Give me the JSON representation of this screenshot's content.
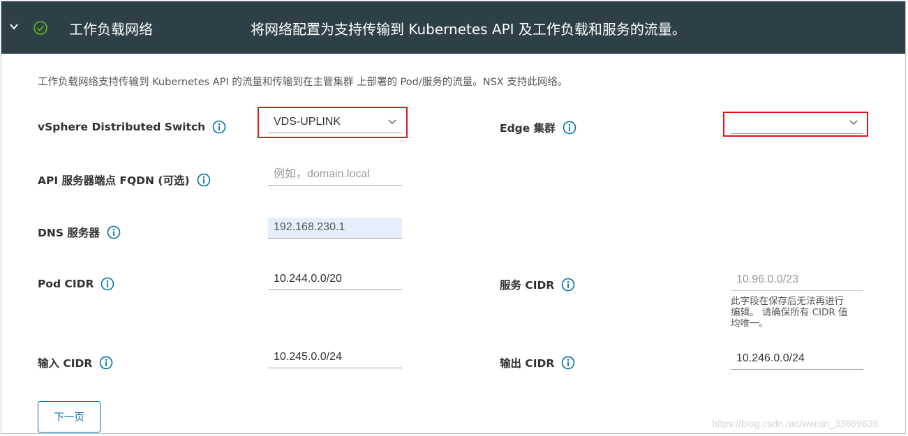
{
  "header": {
    "title": "工作负载网络",
    "description": "将网络配置为支持传输到 Kubernetes API 及工作负载和服务的流量。"
  },
  "intro": "工作负载网络支持传输到 Kubernetes API 的流量和传输到在主管集群 上部署的 Pod/服务的流量。NSX 支持此网络。",
  "fields": {
    "vds": {
      "label": "vSphere Distributed Switch",
      "value": "VDS-UPLINK"
    },
    "edge_cluster": {
      "label": "Edge 集群",
      "value": ""
    },
    "api_fqdn": {
      "label": "API 服务器端点 FQDN (可选)",
      "placeholder": "例如，domain.local"
    },
    "dns": {
      "label": "DNS 服务器",
      "value": "192.168.230.1"
    },
    "pod_cidr": {
      "label": "Pod CIDR",
      "value": "10.244.0.0/20"
    },
    "service_cidr": {
      "label": "服务 CIDR",
      "value": "10.96.0.0/23",
      "helper_lines": [
        "此字段在保存后无法再进行",
        "编辑。 请确保所有 CIDR 值",
        "均唯一。"
      ]
    },
    "ingress_cidr": {
      "label": "输入 CIDR",
      "value": "10.245.0.0/24"
    },
    "egress_cidr": {
      "label": "输出 CIDR",
      "value": "10.246.0.0/24"
    }
  },
  "buttons": {
    "next": "下一页"
  },
  "watermark": "https://blog.csdn.net/weixin_33669839",
  "colors": {
    "header_bg": "#2d4048",
    "info_icon": "#0072a3",
    "check_icon": "#5eb715",
    "highlight_box": "#e0151b",
    "dns_fill": "#e6eefb"
  }
}
